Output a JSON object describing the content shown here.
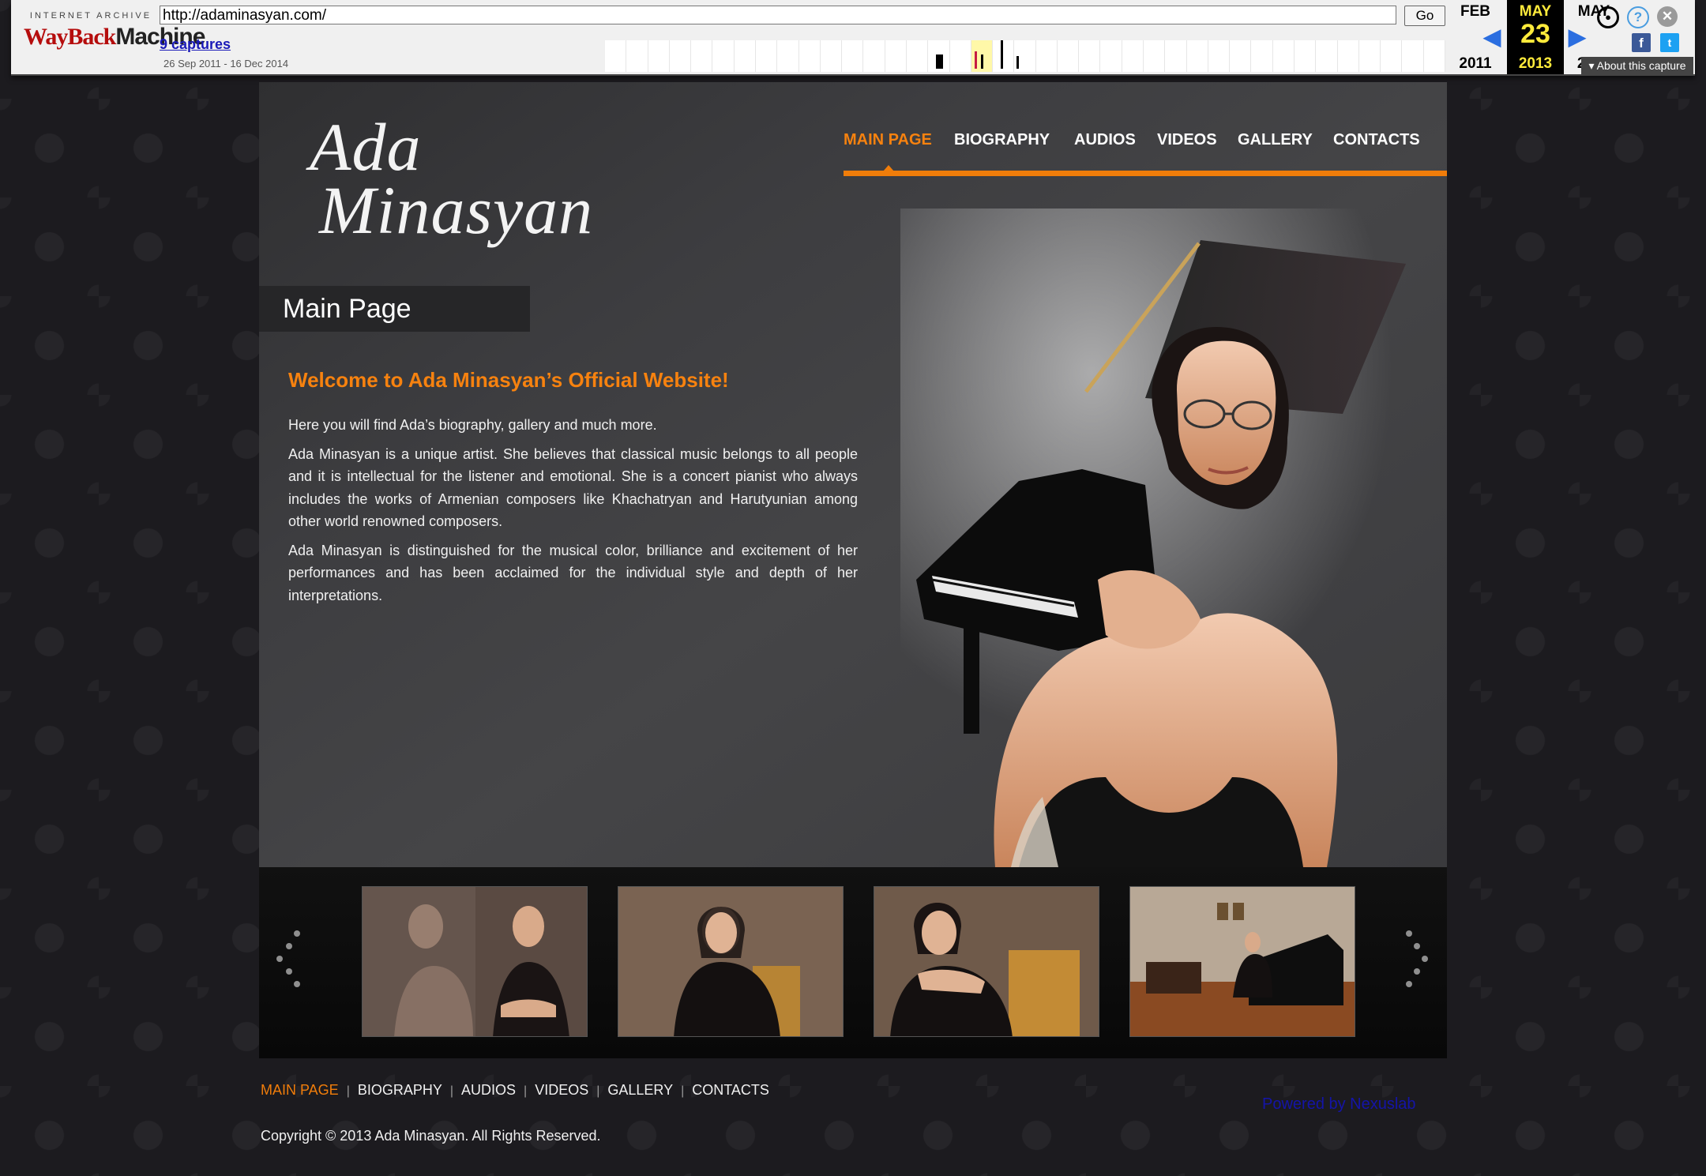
{
  "wayback": {
    "logo_top": "INTERNET ARCHIVE",
    "logo_way": "WayBack",
    "logo_machine": "Machine",
    "url": "http://adaminasyan.com/",
    "go_label": "Go",
    "captures_label": "9 captures",
    "date_range": "26 Sep 2011 - 16 Dec 2014",
    "prev_month": "FEB",
    "prev_year": "2011",
    "cur_month": "MAY",
    "cur_day": "23",
    "cur_year": "2013",
    "next_month": "MAY",
    "next_year": "2014",
    "about_label": "About this capture",
    "colors": {
      "accent": "#2b6ee0",
      "current_bg": "#000000",
      "current_fg": "#ffeb3b"
    }
  },
  "site": {
    "logo_line1": "Ada",
    "logo_line2": "Minasyan",
    "nav": [
      "MAIN PAGE",
      "BIOGRAPHY",
      "AUDIOS",
      "VIDEOS",
      "GALLERY",
      "CONTACTS"
    ],
    "active_nav": "MAIN PAGE",
    "page_title": "Main Page",
    "welcome": "Welcome to Ada Minasyan’s Official Website!",
    "paragraphs": [
      "Here you will find Ada’s biography, gallery and much more.",
      "Ada Minasyan is a unique artist. She believes that classical music belongs to all people and it is intellectual for the listener and emotional. She is a concert pianist who always includes the works of Armenian composers like Khachatryan and Harutyunian among other world renowned composers.",
      "Ada Minasyan is distinguished for the musical color, brilliance and excitement of her performances and has been acclaimed for the individual style and depth of her interpretations."
    ],
    "accent_color": "#f07d0a"
  },
  "gallery": {
    "thumbnails": [
      "two-portraits-thumbnail",
      "seated-portrait-thumbnail",
      "chair-portrait-thumbnail",
      "piano-room-thumbnail"
    ]
  },
  "footer": {
    "nav": [
      "MAIN PAGE",
      "BIOGRAPHY",
      "AUDIOS",
      "VIDEOS",
      "GALLERY",
      "CONTACTS"
    ],
    "powered": "Powered by Nexuslab",
    "copyright": "Copyright © 2013 Ada Minasyan. All Rights Reserved."
  }
}
